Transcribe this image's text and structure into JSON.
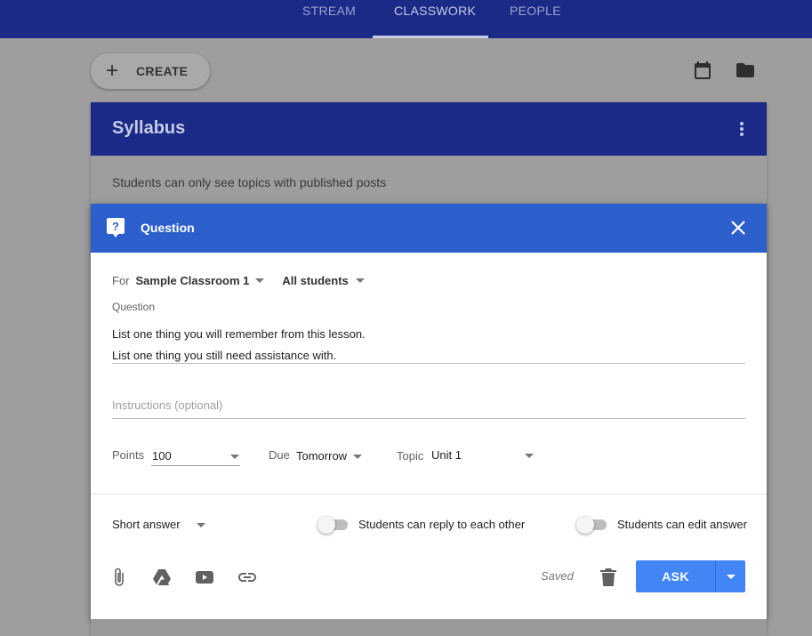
{
  "nav": {
    "tabs": [
      {
        "label": "STREAM"
      },
      {
        "label": "CLASSWORK"
      },
      {
        "label": "PEOPLE"
      }
    ]
  },
  "toolbar": {
    "create_label": "CREATE",
    "calendar_icon": "calendar-icon",
    "folder_icon": "folder-icon"
  },
  "topic": {
    "title": "Syllabus",
    "note": "Students can only see topics with published posts"
  },
  "dialog": {
    "title": "Question",
    "for_label": "For",
    "class_value": "Sample Classroom 1",
    "students_value": "All students",
    "question_label": "Question",
    "question_lines": [
      "List one thing you will remember from this lesson.",
      "List one thing you still need assistance with."
    ],
    "instructions_placeholder": "Instructions (optional)",
    "points_label": "Points",
    "points_value": "100",
    "due_label": "Due",
    "due_value": "Tomorrow",
    "topic_label": "Topic",
    "topic_value": "Unit 1",
    "answer_type": "Short answer",
    "reply_toggle_label": "Students can reply to each other",
    "edit_toggle_label": "Students can edit answer",
    "saved_text": "Saved",
    "ask_label": "ASK"
  },
  "colors": {
    "header": "#1a2a86",
    "dialog_header": "#2d5fcc",
    "ask_button": "#4285f4"
  }
}
